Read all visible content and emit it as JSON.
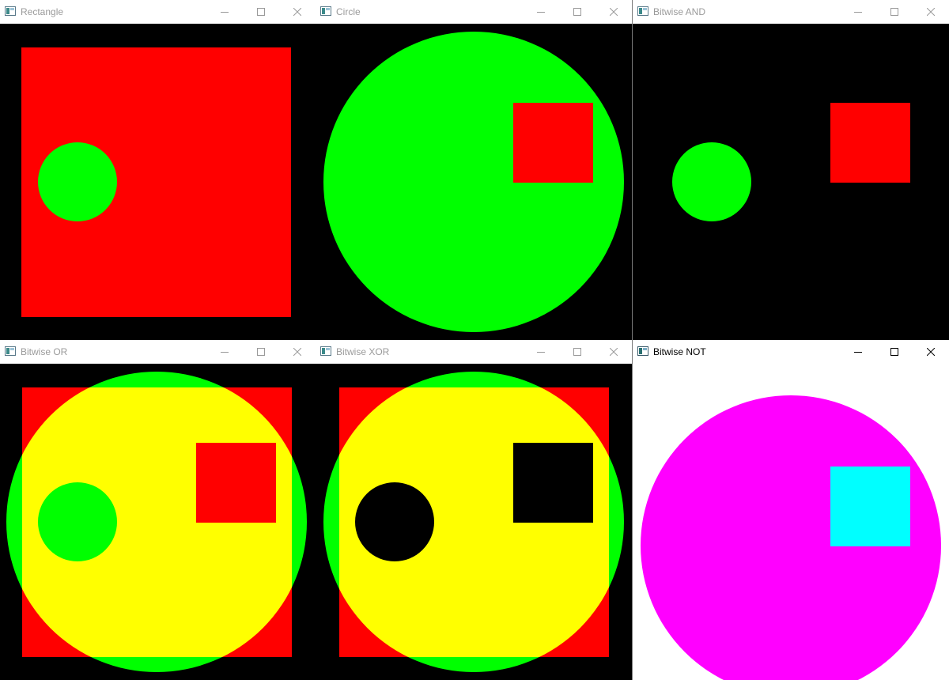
{
  "colors": {
    "black": "#000000",
    "white": "#ffffff",
    "red": "#ff0000",
    "green": "#00ff00",
    "yellow": "#ffff00",
    "magenta": "#ff00ff",
    "cyan": "#00ffff",
    "title_inactive": "#9a9a9a",
    "title_active": "#000000"
  },
  "icons": {
    "app": "opencv-window-icon",
    "minimize": "minimize-icon",
    "maximize": "maximize-icon",
    "close": "close-icon"
  },
  "windows": [
    {
      "title": "Rectangle",
      "active": false
    },
    {
      "title": "Circle",
      "active": false
    },
    {
      "title": "Bitwise AND",
      "active": false
    },
    {
      "title": "Bitwise OR",
      "active": false
    },
    {
      "title": "Bitwise XOR",
      "active": false
    },
    {
      "title": "Bitwise NOT",
      "active": true
    }
  ]
}
